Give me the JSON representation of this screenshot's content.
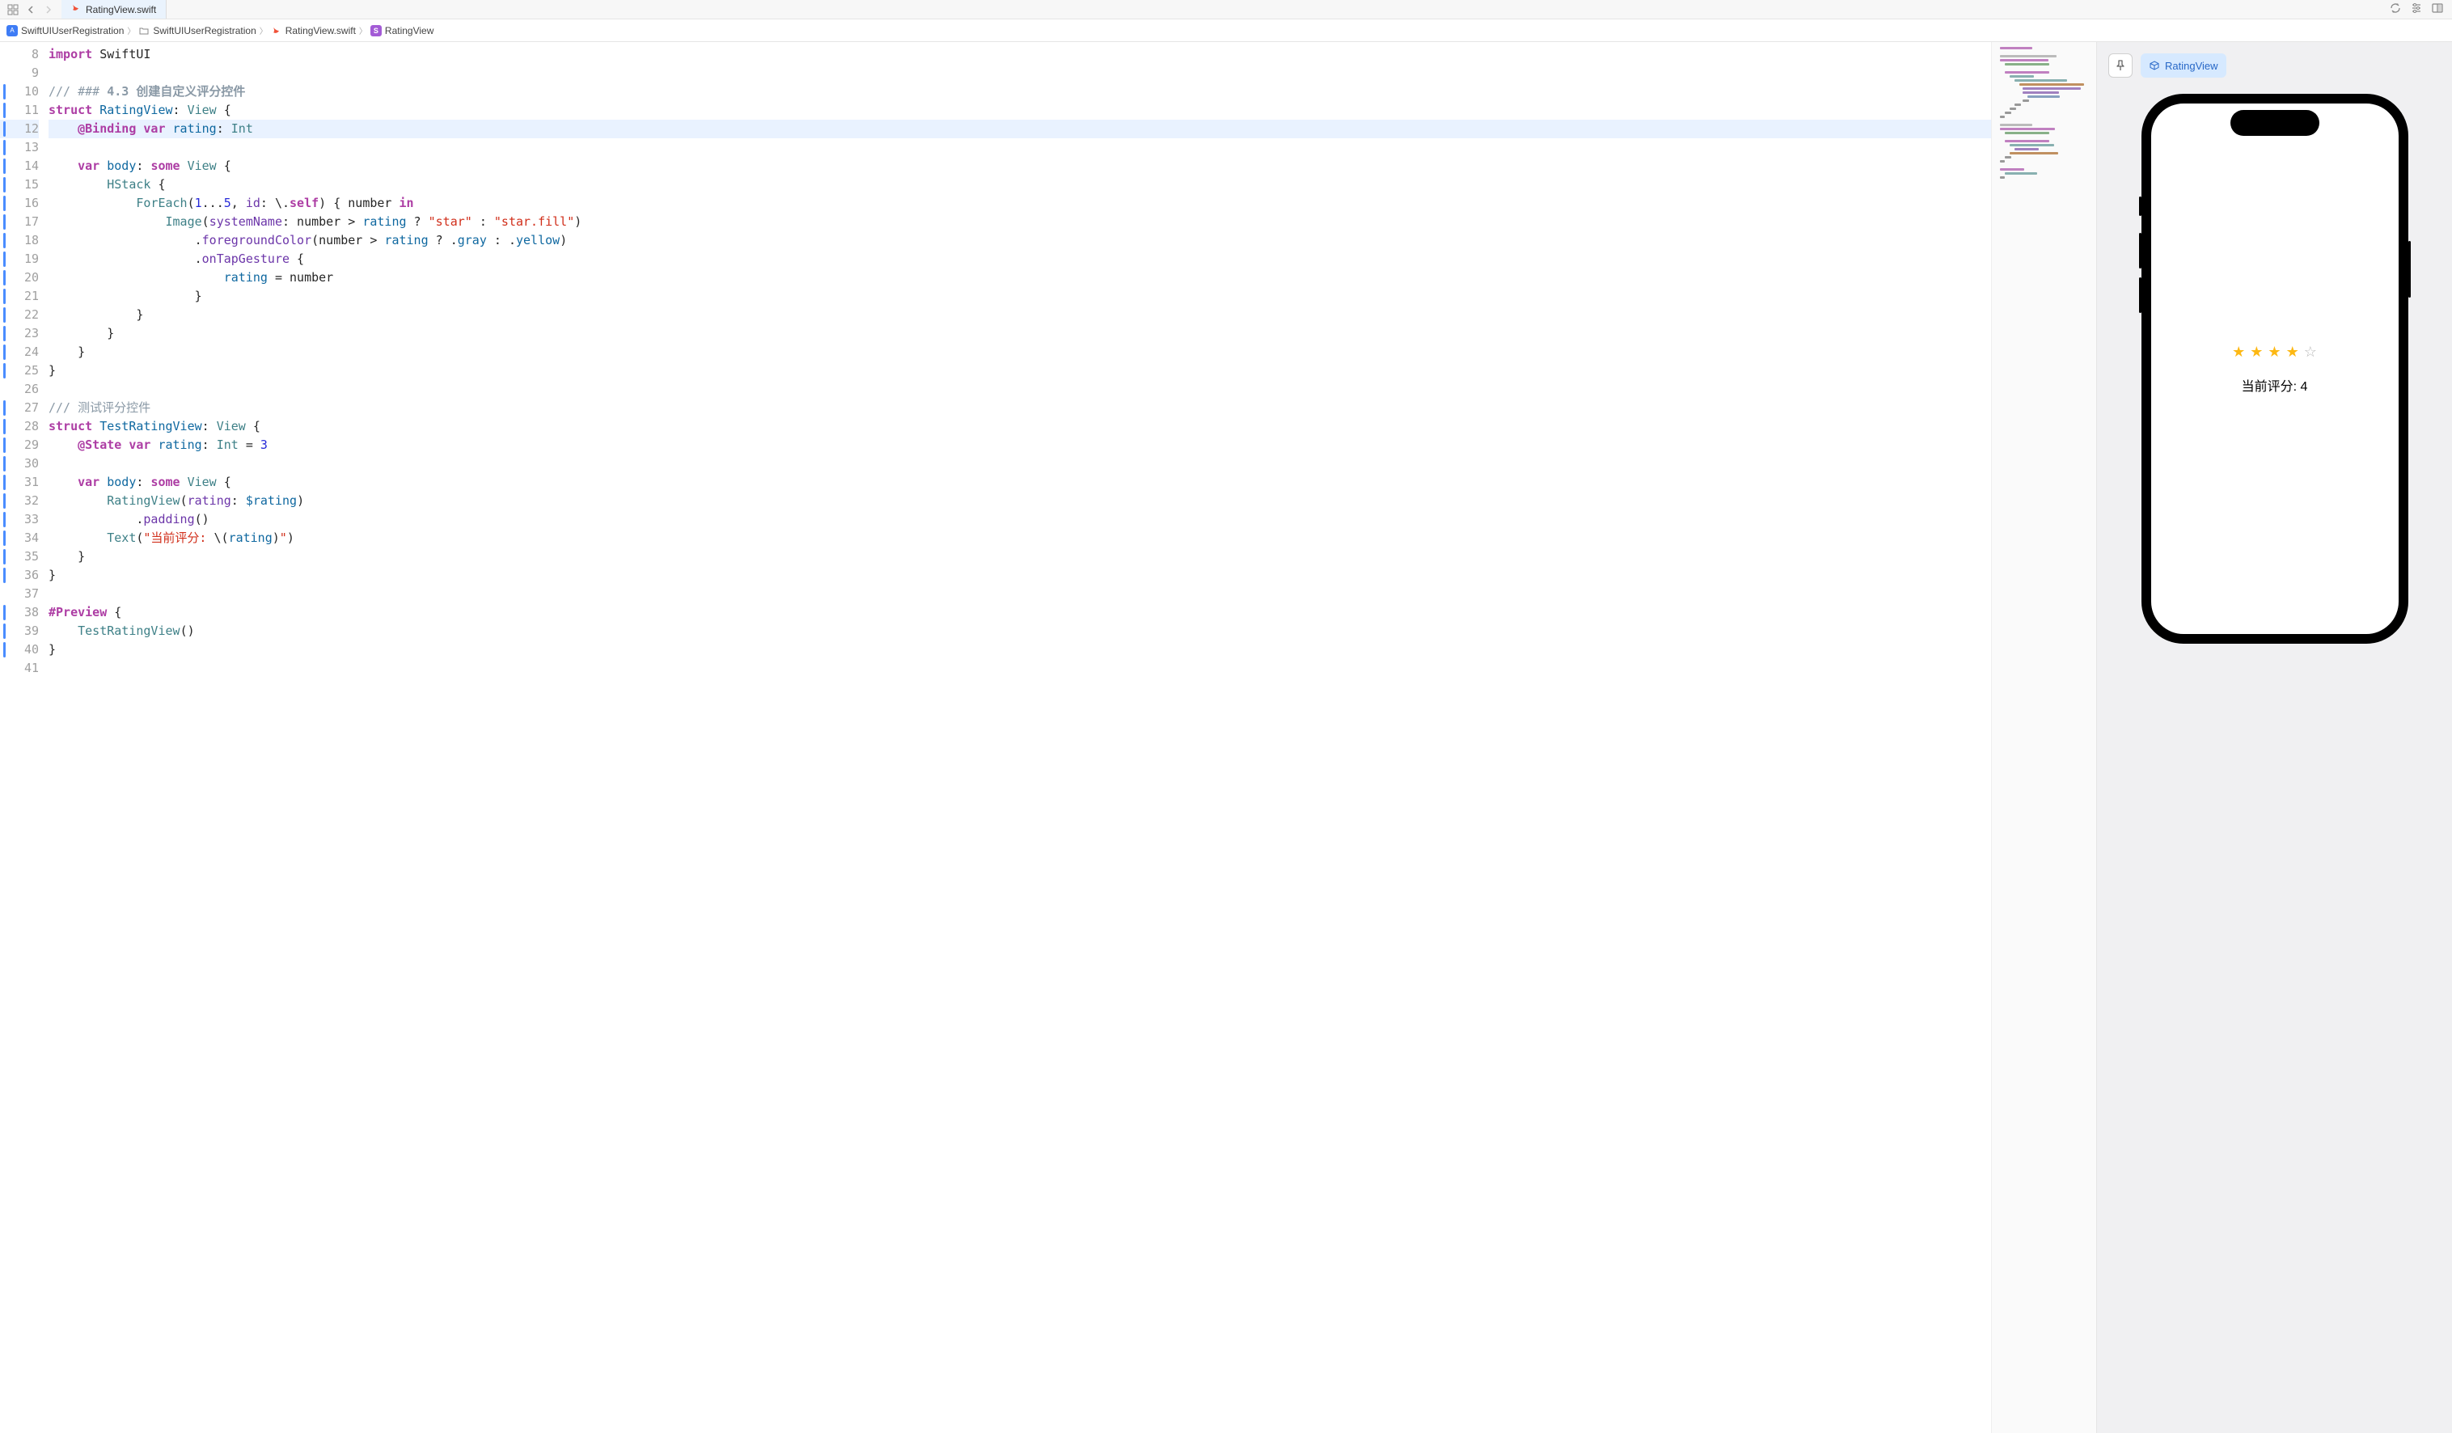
{
  "tab": {
    "title": "RatingView.swift"
  },
  "breadcrumb": [
    {
      "icon": "app",
      "label": "SwiftUIUserRegistration"
    },
    {
      "icon": "folder",
      "label": "SwiftUIUserRegistration"
    },
    {
      "icon": "swift",
      "label": "RatingView.swift"
    },
    {
      "icon": "struct",
      "label": "RatingView"
    }
  ],
  "preview": {
    "chip_label": "RatingView",
    "rating_value": 4,
    "rating_max": 5,
    "rating_text": "当前评分: 4"
  },
  "editor": {
    "first_line_number": 8,
    "highlighted_line": 12,
    "change_bar_lines": [
      10,
      11,
      12,
      13,
      14,
      15,
      16,
      17,
      18,
      19,
      20,
      21,
      22,
      23,
      24,
      25,
      27,
      28,
      29,
      30,
      31,
      32,
      33,
      34,
      35,
      36,
      38,
      39,
      40
    ],
    "lines": [
      [
        [
          "kw",
          "import"
        ],
        [
          "plain",
          " SwiftUI"
        ]
      ],
      [],
      [
        [
          "comment",
          "/// ### "
        ],
        [
          "strong-comment",
          "4.3 创建自定义评分控件"
        ]
      ],
      [
        [
          "kw",
          "struct"
        ],
        [
          "plain",
          " "
        ],
        [
          "typedecl",
          "RatingView"
        ],
        [
          "plain",
          ": "
        ],
        [
          "type",
          "View"
        ],
        [
          "plain",
          " {"
        ]
      ],
      [
        [
          "plain",
          "    "
        ],
        [
          "kw",
          "@Binding"
        ],
        [
          "plain",
          " "
        ],
        [
          "kw",
          "var"
        ],
        [
          "plain",
          " "
        ],
        [
          "ident",
          "rating"
        ],
        [
          "plain",
          ": "
        ],
        [
          "type",
          "Int"
        ]
      ],
      [],
      [
        [
          "plain",
          "    "
        ],
        [
          "kw",
          "var"
        ],
        [
          "plain",
          " "
        ],
        [
          "ident",
          "body"
        ],
        [
          "plain",
          ": "
        ],
        [
          "kw",
          "some"
        ],
        [
          "plain",
          " "
        ],
        [
          "type",
          "View"
        ],
        [
          "plain",
          " {"
        ]
      ],
      [
        [
          "plain",
          "        "
        ],
        [
          "type",
          "HStack"
        ],
        [
          "plain",
          " {"
        ]
      ],
      [
        [
          "plain",
          "            "
        ],
        [
          "type",
          "ForEach"
        ],
        [
          "plain",
          "("
        ],
        [
          "num",
          "1"
        ],
        [
          "plain",
          "..."
        ],
        [
          "num",
          "5"
        ],
        [
          "plain",
          ", "
        ],
        [
          "param",
          "id"
        ],
        [
          "plain",
          ": \\."
        ],
        [
          "kw",
          "self"
        ],
        [
          "plain",
          ") { number "
        ],
        [
          "kw",
          "in"
        ]
      ],
      [
        [
          "plain",
          "                "
        ],
        [
          "type",
          "Image"
        ],
        [
          "plain",
          "("
        ],
        [
          "param",
          "systemName"
        ],
        [
          "plain",
          ": number > "
        ],
        [
          "ident",
          "rating"
        ],
        [
          "plain",
          " ? "
        ],
        [
          "str",
          "\"star\""
        ],
        [
          "plain",
          " : "
        ],
        [
          "str",
          "\"star.fill\""
        ],
        [
          "plain",
          ")"
        ]
      ],
      [
        [
          "plain",
          "                    ."
        ],
        [
          "method",
          "foregroundColor"
        ],
        [
          "plain",
          "(number > "
        ],
        [
          "ident",
          "rating"
        ],
        [
          "plain",
          " ? ."
        ],
        [
          "ident",
          "gray"
        ],
        [
          "plain",
          " : ."
        ],
        [
          "ident",
          "yellow"
        ],
        [
          "plain",
          ")"
        ]
      ],
      [
        [
          "plain",
          "                    ."
        ],
        [
          "method",
          "onTapGesture"
        ],
        [
          "plain",
          " {"
        ]
      ],
      [
        [
          "plain",
          "                        "
        ],
        [
          "ident",
          "rating"
        ],
        [
          "plain",
          " = number"
        ]
      ],
      [
        [
          "plain",
          "                    }"
        ]
      ],
      [
        [
          "plain",
          "            }"
        ]
      ],
      [
        [
          "plain",
          "        }"
        ]
      ],
      [
        [
          "plain",
          "    }"
        ]
      ],
      [
        [
          "plain",
          "}"
        ]
      ],
      [],
      [
        [
          "comment",
          "/// 测试评分控件"
        ]
      ],
      [
        [
          "kw",
          "struct"
        ],
        [
          "plain",
          " "
        ],
        [
          "typedecl",
          "TestRatingView"
        ],
        [
          "plain",
          ": "
        ],
        [
          "type",
          "View"
        ],
        [
          "plain",
          " {"
        ]
      ],
      [
        [
          "plain",
          "    "
        ],
        [
          "kw",
          "@State"
        ],
        [
          "plain",
          " "
        ],
        [
          "kw",
          "var"
        ],
        [
          "plain",
          " "
        ],
        [
          "ident",
          "rating"
        ],
        [
          "plain",
          ": "
        ],
        [
          "type",
          "Int"
        ],
        [
          "plain",
          " = "
        ],
        [
          "num",
          "3"
        ]
      ],
      [],
      [
        [
          "plain",
          "    "
        ],
        [
          "kw",
          "var"
        ],
        [
          "plain",
          " "
        ],
        [
          "ident",
          "body"
        ],
        [
          "plain",
          ": "
        ],
        [
          "kw",
          "some"
        ],
        [
          "plain",
          " "
        ],
        [
          "type",
          "View"
        ],
        [
          "plain",
          " {"
        ]
      ],
      [
        [
          "plain",
          "        "
        ],
        [
          "type",
          "RatingView"
        ],
        [
          "plain",
          "("
        ],
        [
          "param",
          "rating"
        ],
        [
          "plain",
          ": "
        ],
        [
          "ident",
          "$rating"
        ],
        [
          "plain",
          ")"
        ]
      ],
      [
        [
          "plain",
          "            ."
        ],
        [
          "method",
          "padding"
        ],
        [
          "plain",
          "()"
        ]
      ],
      [
        [
          "plain",
          "        "
        ],
        [
          "type",
          "Text"
        ],
        [
          "plain",
          "("
        ],
        [
          "str",
          "\"当前评分: "
        ],
        [
          "plain",
          "\\("
        ],
        [
          "ident",
          "rating"
        ],
        [
          "plain",
          ")"
        ],
        [
          "str",
          "\""
        ],
        [
          "plain",
          ")"
        ]
      ],
      [
        [
          "plain",
          "    }"
        ]
      ],
      [
        [
          "plain",
          "}"
        ]
      ],
      [],
      [
        [
          "kw",
          "#Preview"
        ],
        [
          "plain",
          " {"
        ]
      ],
      [
        [
          "plain",
          "    "
        ],
        [
          "type",
          "TestRatingView"
        ],
        [
          "plain",
          "()"
        ]
      ],
      [
        [
          "plain",
          "}"
        ]
      ],
      []
    ]
  },
  "minimap_lines": [
    {
      "w": 40,
      "c": "#c080c0",
      "ml": 4
    },
    {
      "w": 0
    },
    {
      "w": 70,
      "c": "#bbb",
      "ml": 4
    },
    {
      "w": 60,
      "c": "#c080c0",
      "ml": 4
    },
    {
      "w": 55,
      "c": "#88b088",
      "ml": 10
    },
    {
      "w": 0
    },
    {
      "w": 55,
      "c": "#c080c0",
      "ml": 10
    },
    {
      "w": 30,
      "c": "#88b0b0",
      "ml": 16
    },
    {
      "w": 65,
      "c": "#88b0b0",
      "ml": 22
    },
    {
      "w": 80,
      "c": "#c09060",
      "ml": 28
    },
    {
      "w": 72,
      "c": "#a080c0",
      "ml": 32
    },
    {
      "w": 45,
      "c": "#a080c0",
      "ml": 32
    },
    {
      "w": 40,
      "c": "#88a0c0",
      "ml": 38
    },
    {
      "w": 8,
      "c": "#999",
      "ml": 32
    },
    {
      "w": 8,
      "c": "#999",
      "ml": 22
    },
    {
      "w": 8,
      "c": "#999",
      "ml": 16
    },
    {
      "w": 8,
      "c": "#999",
      "ml": 10
    },
    {
      "w": 6,
      "c": "#999",
      "ml": 4
    },
    {
      "w": 0
    },
    {
      "w": 40,
      "c": "#bbb",
      "ml": 4
    },
    {
      "w": 68,
      "c": "#c080c0",
      "ml": 4
    },
    {
      "w": 55,
      "c": "#88b088",
      "ml": 10
    },
    {
      "w": 0
    },
    {
      "w": 55,
      "c": "#c080c0",
      "ml": 10
    },
    {
      "w": 55,
      "c": "#88b0b0",
      "ml": 16
    },
    {
      "w": 30,
      "c": "#a080c0",
      "ml": 22
    },
    {
      "w": 60,
      "c": "#c09060",
      "ml": 16
    },
    {
      "w": 8,
      "c": "#999",
      "ml": 10
    },
    {
      "w": 6,
      "c": "#999",
      "ml": 4
    },
    {
      "w": 0
    },
    {
      "w": 30,
      "c": "#c080c0",
      "ml": 4
    },
    {
      "w": 40,
      "c": "#88b0b0",
      "ml": 10
    },
    {
      "w": 6,
      "c": "#999",
      "ml": 4
    }
  ]
}
